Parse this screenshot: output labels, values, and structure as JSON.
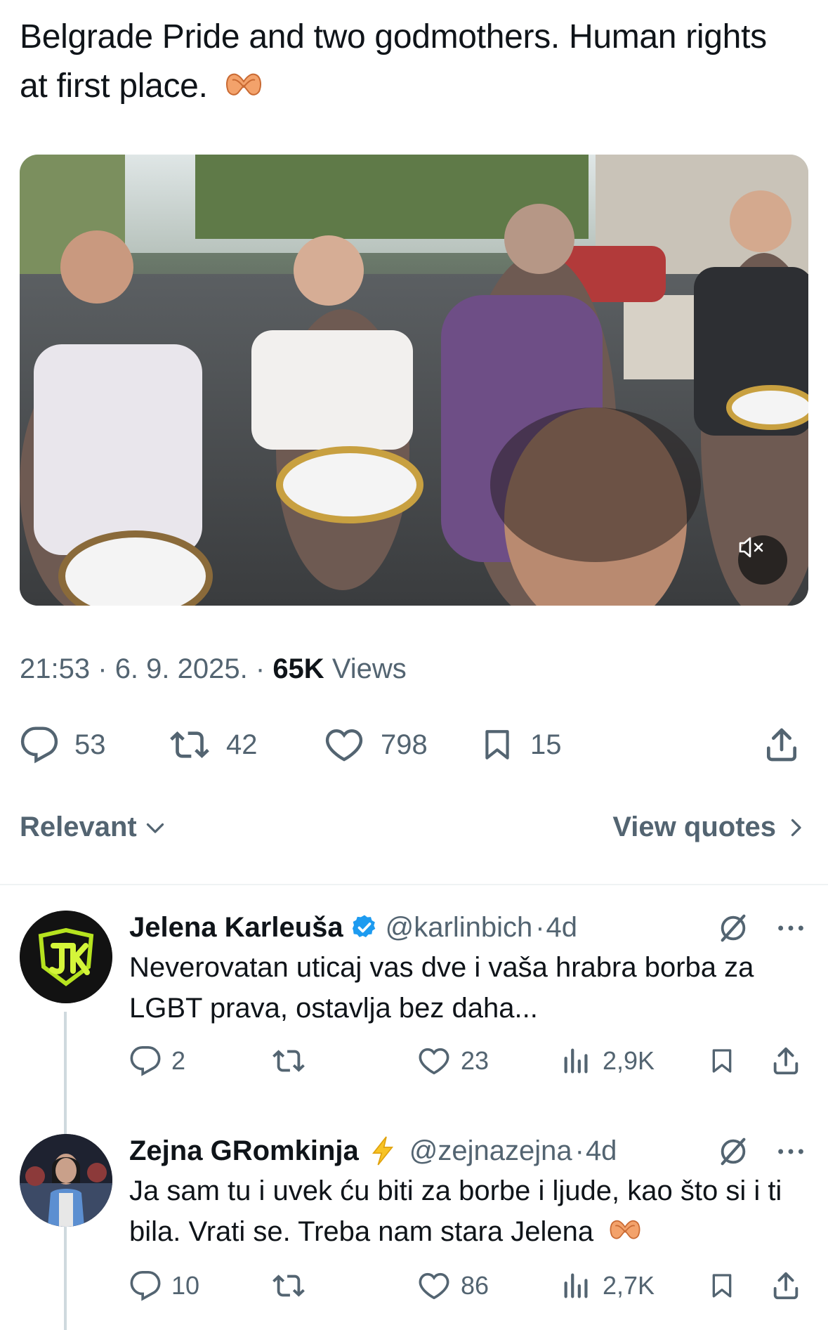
{
  "tweet": {
    "text": "Belgrade Pride and two godmothers. Human rights at first place.",
    "emoji": "heart-hands-emoji",
    "media": {
      "kind": "video",
      "muted": true,
      "icon": "speaker-muted-icon"
    },
    "time": "21:53",
    "date": "6. 9. 2025.",
    "sep": "·",
    "views_count": "65K",
    "views_label": "Views"
  },
  "actions": {
    "replies": "53",
    "reposts": "42",
    "likes": "798",
    "bookmarks": "15"
  },
  "sort": {
    "label": "Relevant",
    "view_quotes": "View quotes"
  },
  "replies": [
    {
      "name": "Jelena Karleuša",
      "verified": true,
      "handle": "@karlinbich",
      "age": "4d",
      "text": "Neverovatan uticaj vas dve i vaša hrabra borba za LGBT prava, ostavlja bez daha...",
      "replies": "2",
      "reposts": "",
      "likes": "23",
      "views": "2,9K"
    },
    {
      "name": "Zejna GRomkinja",
      "badge": "lightning-emoji",
      "handle": "@zejnazejna",
      "age": "4d",
      "text": "Ja sam tu i uvek ću biti za borbe i ljude, kao što si i ti bila. Vrati se. Treba nam stara Jelena",
      "replies": "10",
      "reposts": "",
      "likes": "86",
      "views": "2,7K"
    }
  ],
  "colors": {
    "text": "#0f1419",
    "secondary": "#536471",
    "verified": "#1d9bf0",
    "divider": "#eff3f4",
    "thread": "#cfd9de"
  }
}
